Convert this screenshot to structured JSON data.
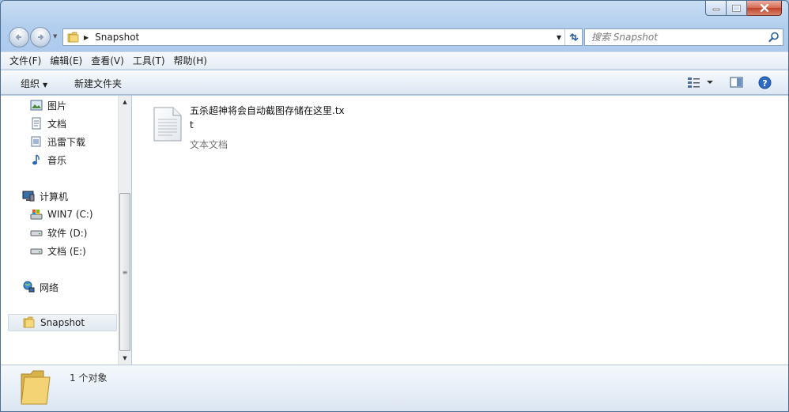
{
  "window": {
    "title_buttons": {
      "minimize": "minimize-icon",
      "maximize": "maximize-icon",
      "close": "close-icon"
    }
  },
  "address": {
    "path": "Snapshot",
    "search_placeholder": "搜索 Snapshot"
  },
  "menu": {
    "items": [
      "文件(F)",
      "编辑(E)",
      "查看(V)",
      "工具(T)",
      "帮助(H)"
    ]
  },
  "toolbar": {
    "organize_label": "组织",
    "new_folder_label": "新建文件夹"
  },
  "nav": {
    "items": [
      {
        "label": "图片",
        "icon": "pictures-icon"
      },
      {
        "label": "文档",
        "icon": "documents-icon"
      },
      {
        "label": "迅雷下载",
        "icon": "download-folder-icon"
      },
      {
        "label": "音乐",
        "icon": "music-icon"
      },
      {
        "label": "计算机",
        "icon": "computer-icon"
      },
      {
        "label": "WIN7 (C:)",
        "icon": "system-drive-icon"
      },
      {
        "label": "软件 (D:)",
        "icon": "drive-icon"
      },
      {
        "label": "文档 (E:)",
        "icon": "drive-icon"
      },
      {
        "label": "网络",
        "icon": "network-icon"
      },
      {
        "label": "Snapshot",
        "icon": "folder-icon"
      }
    ]
  },
  "files": [
    {
      "name": "五杀超神将会自动截图存储在这里.txt",
      "type": "文本文档",
      "icon": "text-file-icon"
    }
  ],
  "details": {
    "count": "1 个对象"
  },
  "colors": {
    "frame": "#aecbed",
    "accent_blue": "#2a5d9e",
    "close_red": "#c0432b"
  }
}
